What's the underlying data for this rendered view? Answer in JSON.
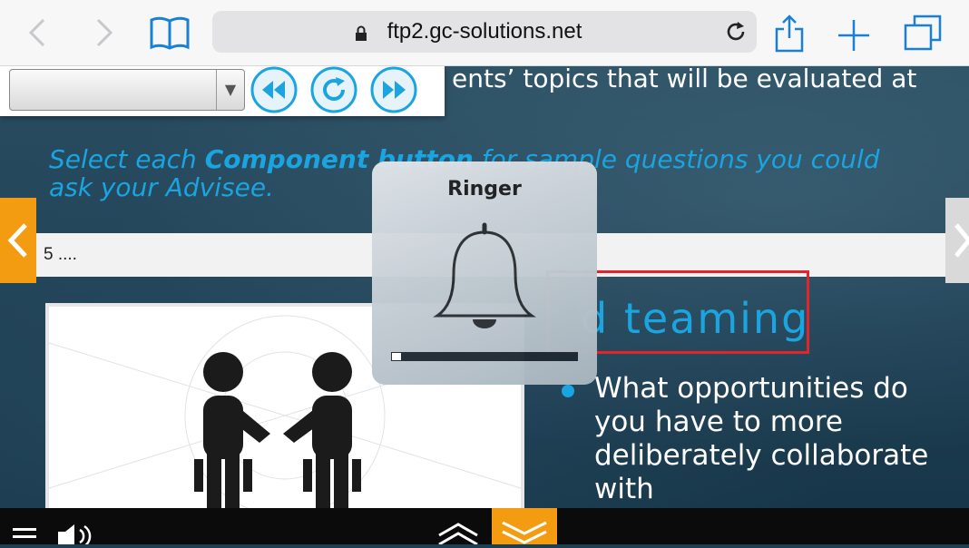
{
  "safari": {
    "url": "ftp2.gc-solutions.net",
    "icons": [
      "back-arrow-icon",
      "forward-arrow-icon",
      "bookmarks-icon",
      "lock-icon",
      "reload-icon",
      "share-icon",
      "new-tab-icon",
      "tabs-icon"
    ]
  },
  "player_toolbar": {
    "dropdown_value": "",
    "buttons": [
      "rewind-icon",
      "replay-icon",
      "fast-forward-icon"
    ]
  },
  "content": {
    "intro_fragment": "ents’ topics that will be evaluated at",
    "instruction_prefix": "Select each ",
    "instruction_bold": "Component button",
    "instruction_suffix": " for sample questions you could ask your Advisee.",
    "progress_text": "5 ....",
    "heading_fragment": "d teaming",
    "bullet_text": "What opportunities do you have to more deliberately collaborate with"
  },
  "ringer": {
    "title": "Ringer",
    "level": 0.05
  },
  "colors": {
    "accent_blue": "#1aa4e0",
    "nav_orange": "#f39c12",
    "highlight_red": "#e0262b"
  }
}
